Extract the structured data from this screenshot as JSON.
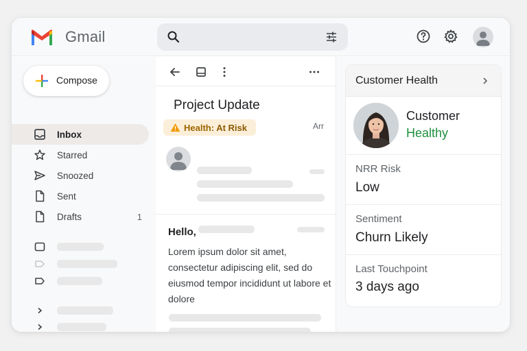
{
  "header": {
    "brand": "Gmail",
    "search_placeholder": "",
    "icons": [
      "gmail-logo",
      "search-icon",
      "filter-options-icon",
      "help-icon",
      "settings-icon",
      "account-avatar"
    ]
  },
  "sidebar": {
    "compose_label": "Compose",
    "items": [
      {
        "label": "Inbox",
        "icon": "inbox-icon",
        "active": true,
        "count": ""
      },
      {
        "label": "Starred",
        "icon": "star-icon",
        "active": false,
        "count": ""
      },
      {
        "label": "Snoozed",
        "icon": "send-arrow-icon",
        "active": false,
        "count": ""
      },
      {
        "label": "Sent",
        "icon": "file-icon",
        "active": false,
        "count": ""
      },
      {
        "label": "Drafts",
        "icon": "file-icon",
        "active": false,
        "count": "1"
      }
    ]
  },
  "email": {
    "subject": "Project Update",
    "health_badge_prefix": "Health:",
    "health_badge_value": "At Risk",
    "partial_text": "Arr",
    "greeting": "Hello,",
    "body": "Lorem ipsum dolor sit amet, consectetur adipiscing elit, sed do eiusmod tempor incididunt ut labore et dolore"
  },
  "health_panel": {
    "title": "Customer Health",
    "customer_label": "Customer",
    "customer_status": "Healthy",
    "metrics": [
      {
        "label": "NRR Risk",
        "value": "Low"
      },
      {
        "label": "Sentiment",
        "value": "Churn Likely"
      },
      {
        "label": "Last Touchpoint",
        "value": "3 days ago"
      }
    ]
  },
  "colors": {
    "healthy": "#1e8e3e",
    "at_risk_bg": "#fcefd9",
    "at_risk_text": "#8a5a00",
    "warning_icon": "#f29900",
    "active_nav_bg": "#eeeae8"
  }
}
